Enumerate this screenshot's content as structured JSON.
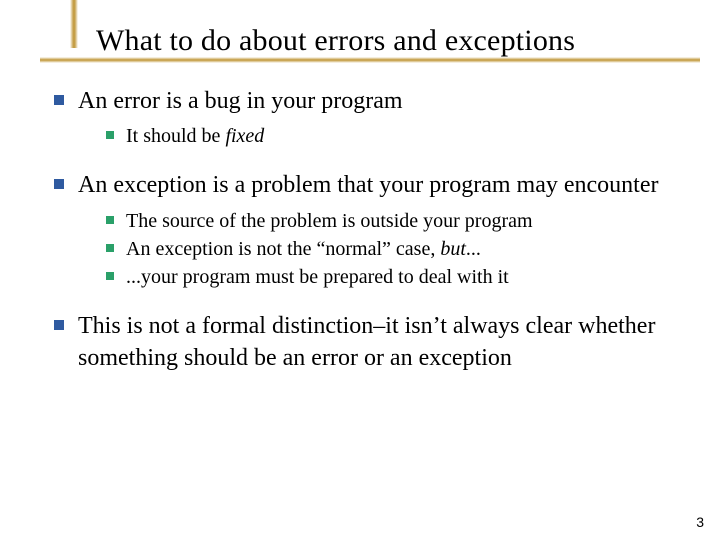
{
  "title": "What to do about errors and exceptions",
  "bullets": {
    "b1": "An error is a bug in your program",
    "b1_sub": {
      "s1_prefix": "It should be ",
      "s1_italic": "fixed"
    },
    "b2": "An exception is a problem that your program may encounter",
    "b2_sub": {
      "s1": "The source of the problem is outside your program",
      "s2_prefix": "An exception is not the “normal” case, ",
      "s2_italic": "but",
      "s2_suffix": "...",
      "s3": "...your program must be prepared to deal with it"
    },
    "b3": "This is not a formal distinction–it isn’t always clear whether something should be an error or an exception"
  },
  "page_number": "3"
}
